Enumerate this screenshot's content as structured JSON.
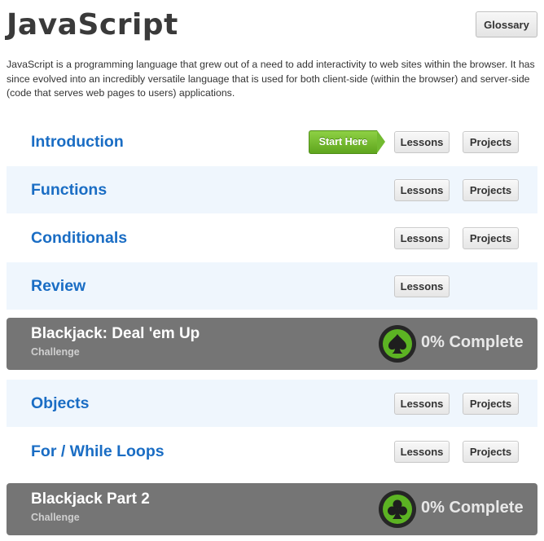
{
  "header": {
    "title": "JavaScript",
    "glossary_label": "Glossary",
    "description": "JavaScript is a programming language that grew out of a need to add interactivity to web sites within the browser. It has since evolved into an incredibly versatile language that is used for both client-side (within the browser) and server-side (code that serves web pages to users) applications."
  },
  "buttons": {
    "lessons": "Lessons",
    "projects": "Projects",
    "start_here": "Start Here"
  },
  "units": [
    {
      "title": "Introduction"
    },
    {
      "title": "Functions"
    },
    {
      "title": "Conditionals"
    },
    {
      "title": "Review"
    },
    {
      "title": "Objects"
    },
    {
      "title": "For / While Loops"
    }
  ],
  "challenges": [
    {
      "title": "Blackjack: Deal 'em Up",
      "subtitle": "Challenge",
      "progress": "0% Complete",
      "icon": "spade-icon"
    },
    {
      "title": "Blackjack Part 2",
      "subtitle": "Challenge",
      "progress": "0% Complete",
      "icon": "club-icon"
    }
  ],
  "colors": {
    "title_blue": "#1a6dc4",
    "accent_green": "#5cb323",
    "challenge_bg": "#757575",
    "alt_row_bg": "#eff6fd"
  }
}
